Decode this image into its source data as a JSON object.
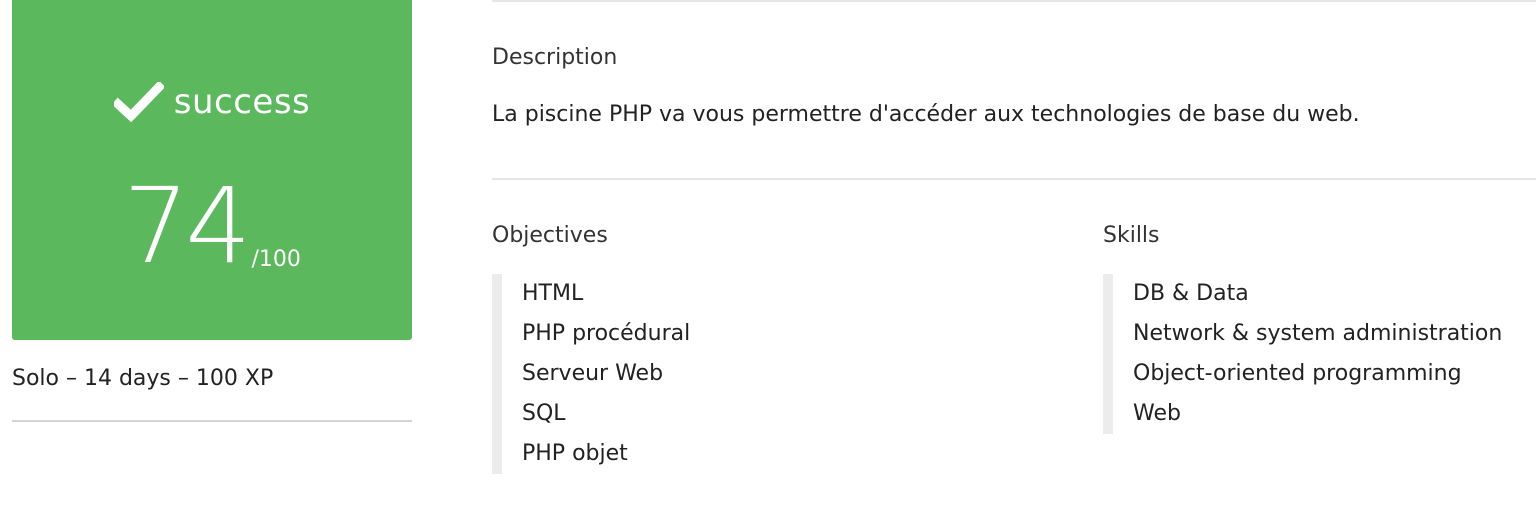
{
  "score_card": {
    "status": "success",
    "score": "74",
    "max": "/100",
    "color": "#5cb85c"
  },
  "project_meta": "Solo – 14 days – 100 XP",
  "description": {
    "heading": "Description",
    "text": "La piscine PHP va vous permettre d'accéder aux technologies de base du web."
  },
  "objectives": {
    "heading": "Objectives",
    "items": [
      "HTML",
      "PHP procédural",
      "Serveur Web",
      "SQL",
      "PHP objet"
    ]
  },
  "skills": {
    "heading": "Skills",
    "items": [
      "DB & Data",
      "Network & system administration",
      "Object-oriented programming",
      "Web"
    ]
  }
}
